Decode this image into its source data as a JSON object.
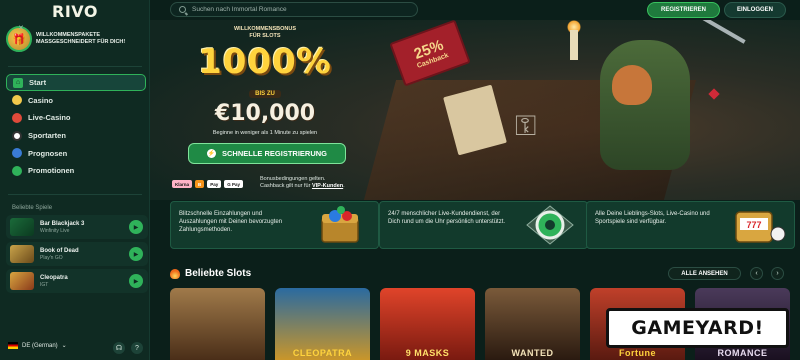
{
  "brand": {
    "logo": "RIVO"
  },
  "welcome": {
    "text_line1": "WILLKOMMENSPAKETE",
    "text_line2": "MASSGESCHNEIDERT FÜR DICH!",
    "close": "✕"
  },
  "nav": {
    "items": [
      {
        "label": "Start",
        "icon": "home-icon",
        "active": true
      },
      {
        "label": "Casino",
        "icon": "casino-icon"
      },
      {
        "label": "Live-Casino",
        "icon": "live-casino-icon"
      },
      {
        "label": "Sportarten",
        "icon": "sports-icon"
      },
      {
        "label": "Prognosen",
        "icon": "predictions-icon"
      },
      {
        "label": "Promotionen",
        "icon": "promotions-icon"
      }
    ]
  },
  "popular_games": {
    "title": "Beliebte Spiele",
    "items": [
      {
        "title": "Bar Blackjack 3",
        "provider": "Winfinity Live"
      },
      {
        "title": "Book of Dead",
        "provider": "Play'n GO"
      },
      {
        "title": "Cleopatra",
        "provider": "IGT"
      }
    ]
  },
  "footer": {
    "language": "DE (German)"
  },
  "header": {
    "search_placeholder": "Suchen nach Immortal Romance",
    "register_label": "REGISTRIEREN",
    "login_label": "EINLOGGEN"
  },
  "hero": {
    "bonus_subtitle_line1": "WILLKOMMENSBONUS",
    "bonus_subtitle_line2": "FÜR SLOTS",
    "bonus_percent": "1000%",
    "bis_zu": "BIS ZU",
    "bonus_amount": "€10,000",
    "bonus_note": "Beginne in weniger als 1 Minute zu spielen",
    "cta_label": "SCHNELLE REGISTRIERUNG",
    "cashback_percent": "25%",
    "cashback_label": "Cashback",
    "payment_logos": [
      "Klarna",
      "B",
      "Pay",
      "G Pay"
    ],
    "terms_line1": "Bonusbedingungen gelten.",
    "terms_line2": "Cashback gilt nur für",
    "terms_vip": "VIP-Kunden",
    "terms_end": "."
  },
  "info_cards": [
    {
      "text": "Blitzschnelle Einzahlungen und Auszahlungen mit Deinen bevorzugten Zahlungsmethoden."
    },
    {
      "text": "24/7 menschlicher Live-Kundendienst, der Dich rund um die Uhr persönlich unterstützt."
    },
    {
      "text": "Alle Deine Lieblings-Slots, Live-Casino und Sportspiele sind verfügbar."
    }
  ],
  "popular_slots": {
    "title": "Beliebte Slots",
    "see_all_label": "ALLE ANSEHEN",
    "prev": "‹",
    "next": "›",
    "items": [
      {
        "label": "",
        "bg": "#6b4a2a"
      },
      {
        "label": "CLEOPATRA",
        "bg": "#1d5a8a"
      },
      {
        "label": "9 MASKS",
        "bg": "#b8321a"
      },
      {
        "label": "WANTED",
        "bg": "#5a3f2a"
      },
      {
        "label": "Fortune",
        "bg": "#a0342a"
      },
      {
        "label": "ROMANCE",
        "bg": "#3a2a4a"
      }
    ]
  },
  "overlay": {
    "watermark": "GAMEYARD!"
  }
}
